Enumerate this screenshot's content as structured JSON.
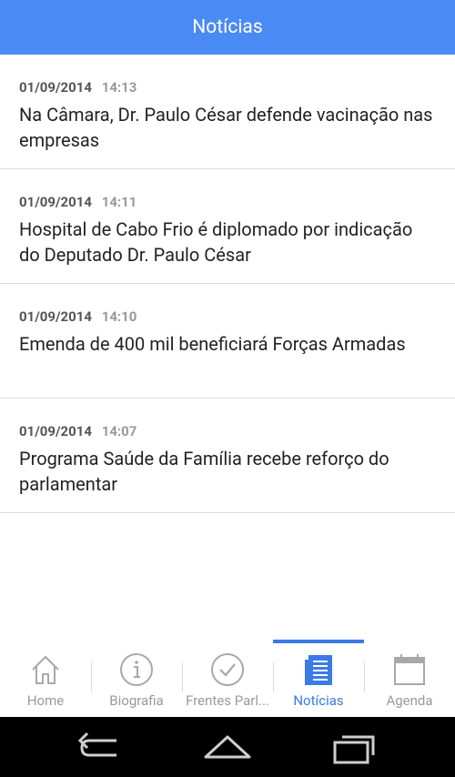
{
  "appbar": {
    "title": "Notícias"
  },
  "news": [
    {
      "date": "01/09/2014",
      "time": "14:13",
      "title": "Na Câmara, Dr. Paulo César defende vacinação nas empresas"
    },
    {
      "date": "01/09/2014",
      "time": "14:11",
      "title": "Hospital de Cabo Frio é diplomado por indicação do Deputado Dr. Paulo César"
    },
    {
      "date": "01/09/2014",
      "time": "14:10",
      "title": "Emenda de 400 mil beneficiará Forças Armadas"
    },
    {
      "date": "01/09/2014",
      "time": "14:07",
      "title": "Programa Saúde da Família recebe reforço do parlamentar"
    }
  ],
  "tabs": [
    {
      "label": "Home",
      "icon": "home-icon"
    },
    {
      "label": "Biografia",
      "icon": "info-icon"
    },
    {
      "label": "Frentes Parl...",
      "icon": "check-circle-icon"
    },
    {
      "label": "Notícias",
      "icon": "news-icon"
    },
    {
      "label": "Agenda",
      "icon": "calendar-icon"
    }
  ],
  "tabs_active": "Notícias",
  "colors": {
    "accent": "#4a8af4",
    "tab_active": "#3a7be6",
    "tab_inactive": "#999999"
  }
}
